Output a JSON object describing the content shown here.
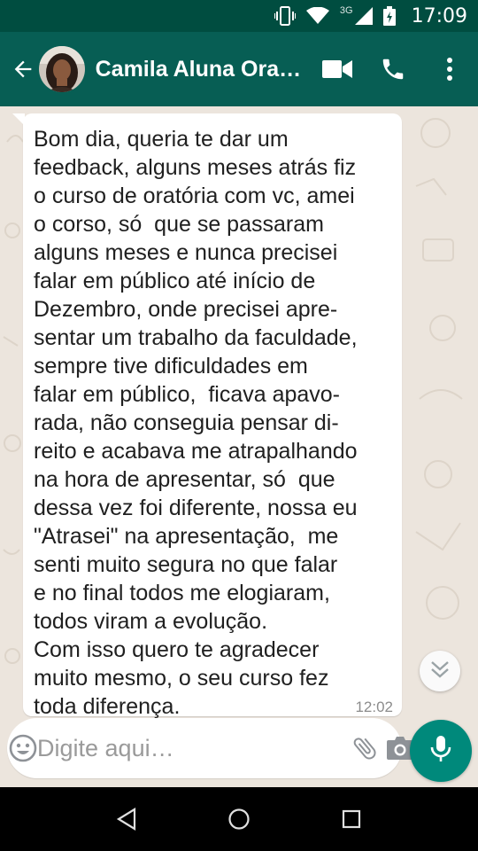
{
  "status_bar": {
    "network": "3G",
    "time": "17:09",
    "icons": [
      "vibrate-icon",
      "wifi-icon",
      "signal-icon",
      "battery-icon"
    ]
  },
  "header": {
    "contact_name": "Camila Aluna Oratória",
    "icons": [
      "back-arrow-icon",
      "avatar",
      "video-call-icon",
      "phone-icon",
      "more-options-icon"
    ]
  },
  "message": {
    "text": "Bom dia, queria te dar um\nfeedback, alguns meses atrás fiz\no curso de oratória com vc, amei\no corso, só  que se passaram\nalguns meses e nunca precisei\nfalar em público até início de\nDezembro, onde precisei apre-\nsentar um trabalho da faculdade,\nsempre tive dificuldades em\nfalar em público,  ficava apavo-\nrada, não conseguia pensar di-\nreito e acabava me atrapalhando\nna hora de apresentar, só  que\ndessa vez foi diferente, nossa eu\n\"Atrasei\" na apresentação,  me\nsenti muito segura no que falar\ne no final todos me elogiaram,\ntodos viram a evolução.\nCom isso quero te agradecer\nmuito mesmo, o seu curso fez\ntoda diferença.",
    "time": "12:02"
  },
  "composer": {
    "placeholder": "Digite aqui…",
    "icons": [
      "emoji-icon",
      "attach-icon",
      "camera-icon",
      "mic-icon"
    ]
  },
  "colors": {
    "header": "#075e54",
    "status_bar": "#004d40",
    "accent": "#00897b",
    "chat_background": "#ece5dd",
    "bubble": "#ffffff"
  }
}
